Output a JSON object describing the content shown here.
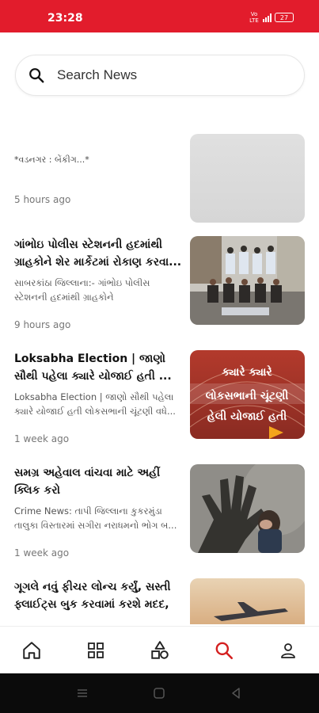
{
  "status_bar": {
    "time": "23:28",
    "network_label": "Vo LTE",
    "battery": "27"
  },
  "search": {
    "placeholder": "Search News"
  },
  "news": [
    {
      "title": "",
      "description": "*વડનગર : બેંકીગ...*",
      "time": "5 hours ago",
      "image": "placeholder"
    },
    {
      "title": "ગાંભોઇ પોલીસ સ્ટેશનની હદમાંથી ગ્રાહકોને શેર માર્કેટમાં રોકાણ કરવા...",
      "description": "સાબરકાંઠા જિલ્લાના:- ગાંભોઇ પોલીસ સ્ટેશનની હદમાંથી ગ્રાહકોને",
      "time": "9 hours ago",
      "image": "police-group-photo"
    },
    {
      "title": "Loksabha Election | જાણો સૌથી પહેલા ક્યારે યોજાઈ હતી ...",
      "description": "Loksabha Election | જાણો સૌથી પહેલા ક્યારે યોજાઈ હતી લોકસભાની ચૂંટણી વધે...",
      "time": "1 week ago",
      "image": "parliament-graphic",
      "image_text": [
        "ક્યારે ક્યારે",
        "લોકસભાની ચૂંટણી",
        "હેલી યોજાઈ હતી"
      ]
    },
    {
      "title": "સમગ્ર અહેવાલ વાંચવા માટે અહીં ક્લિક કરો",
      "description": "Crime News: તાપી જિલ્લાના કુકરમુંડા તાલુકા વિસ્તારમાં સગીરા નરાધમનો ભોગ બ...",
      "time": "1 week ago",
      "image": "shadow-hand-child"
    },
    {
      "title": "ગૂગલે નવું ફીચર લોન્ચ કર્યું, સસ્તી ફ્લાઈટ્સ બુક કરવામાં કરશે મદદ, ...",
      "description": "...",
      "time": "",
      "image": "airplane-sunset"
    }
  ],
  "bottom_nav": [
    {
      "name": "home-icon",
      "active": false
    },
    {
      "name": "categories-icon",
      "active": false
    },
    {
      "name": "shapes-icon",
      "active": false
    },
    {
      "name": "search-icon",
      "active": true
    },
    {
      "name": "profile-icon",
      "active": false
    }
  ],
  "colors": {
    "brand": "#e21c2c",
    "active_nav": "#d42020",
    "inactive_nav": "#222222"
  }
}
